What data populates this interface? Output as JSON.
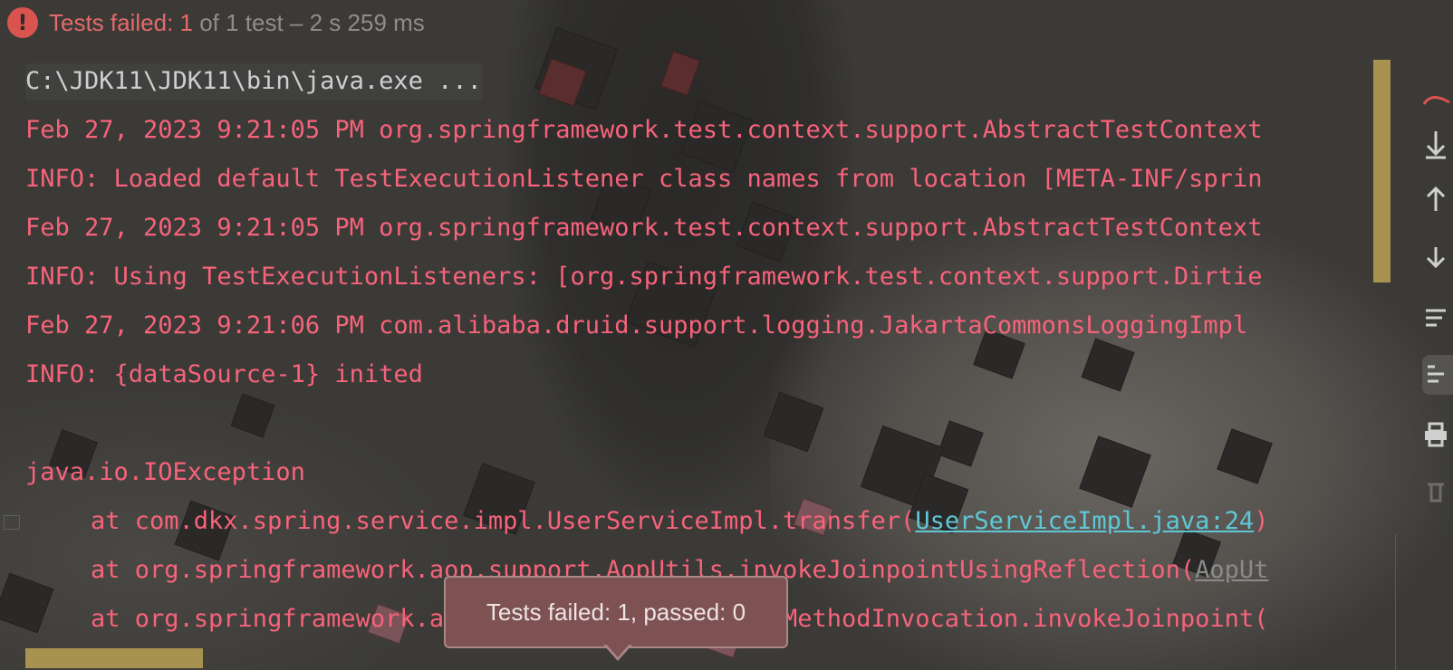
{
  "header": {
    "icon": "error-icon",
    "failed_label": "Tests failed: 1",
    "rest_label": " of 1 test – 2 s 259 ms"
  },
  "console": {
    "lines": [
      "C:\\JDK11\\JDK11\\bin\\java.exe ...",
      "Feb 27, 2023 9:21:05 PM org.springframework.test.context.support.AbstractTestContext",
      "INFO: Loaded default TestExecutionListener class names from location [META-INF/sprin",
      "Feb 27, 2023 9:21:05 PM org.springframework.test.context.support.AbstractTestContext",
      "INFO: Using TestExecutionListeners: [org.springframework.test.context.support.Dirtie",
      "Feb 27, 2023 9:21:06 PM com.alibaba.druid.support.logging.JakartaCommonsLoggingImpl",
      "INFO: {dataSource-1} inited",
      "java.io.IOException"
    ],
    "stack": [
      {
        "prefix": "at com.dkx.spring.service.impl.UserServiceImpl.transfer(",
        "link": "UserServiceImpl.java:24",
        "suffix": ")"
      },
      {
        "prefix": "at org.springframework.aop.support.AopUtils.invokeJoinpointUsingReflection(",
        "link": "AopUt",
        "suffix": ""
      },
      {
        "prefix": "at org.springframework.aop.framework.ReflectiveMethodInvocation.invokeJoinpoint(",
        "link": "",
        "suffix": ""
      }
    ]
  },
  "tooltip": {
    "text": "Tests failed: 1, passed: 0"
  },
  "colors": {
    "error": "#f7637a",
    "link": "#5fc7d6",
    "scrollbar": "#a8924f",
    "tooltip_bg": "#7e5152"
  }
}
